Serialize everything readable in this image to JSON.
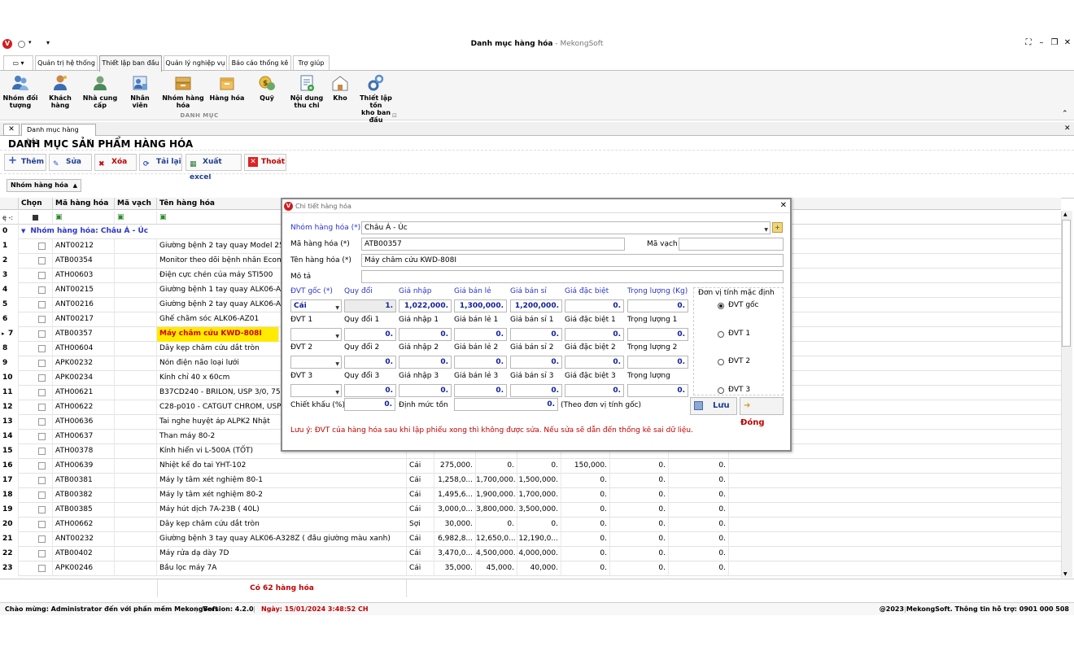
{
  "app": {
    "title": "Danh mục hàng hóa",
    "brand": " - MekongSoft",
    "icon_letter": "V"
  },
  "ribbon": {
    "tabs": [
      "Quản trị hệ thống",
      "Thiết lập ban đầu",
      "Quản lý nghiệp vụ",
      "Báo cáo thống kê",
      "Trợ giúp"
    ],
    "items": [
      {
        "label1": "Nhóm đối",
        "label2": "tượng",
        "icon": "users-group-icon"
      },
      {
        "label1": "Khách",
        "label2": "hàng",
        "icon": "customer-icon"
      },
      {
        "label1": "Nhà cung",
        "label2": "cấp",
        "icon": "supplier-icon"
      },
      {
        "label1": "Nhân viên",
        "label2": "",
        "icon": "employee-icon"
      },
      {
        "label1": "Nhóm hàng",
        "label2": "hóa",
        "icon": "product-group-icon"
      },
      {
        "label1": "Hàng hóa",
        "label2": "",
        "icon": "product-box-icon"
      },
      {
        "label1": "Quỹ",
        "label2": "",
        "icon": "money-bag-icon"
      },
      {
        "label1": "Nội dung",
        "label2": "thu chi",
        "icon": "document-add-icon"
      },
      {
        "label1": "Kho",
        "label2": "",
        "icon": "warehouse-icon"
      },
      {
        "label1": "Thiết lập tồn",
        "label2": "kho ban đầu",
        "icon": "gears-icon"
      }
    ],
    "group_label": "DANH MỤC"
  },
  "doc_tab": "Danh mục hàng hóa",
  "page_title": "DANH MỤC SẢN PHẨM HÀNG HÓA",
  "toolbar": {
    "add": "Thêm",
    "edit": "Sửa",
    "delete": "Xóa",
    "reload": "Tải lại",
    "export": "Xuất excel",
    "exit": "Thoát"
  },
  "group_by": "Nhóm hàng hóa",
  "grid": {
    "headers": {
      "chon": "Chọn",
      "ma": "Mã hàng hóa",
      "mavach": "Mã vạch",
      "ten": "Tên hàng hóa"
    },
    "filter_icon": "ę -:",
    "group_row": {
      "num": "0",
      "label": "Nhóm hàng hóa: Châu Á - Úc"
    },
    "rows": [
      {
        "n": "1",
        "ma": "ANT00212",
        "ten": "Giường bệnh 2 tay quay Model 250",
        "dvt": "",
        "a": "",
        "b": "",
        "c": "",
        "d": "",
        "e": "",
        "f": ""
      },
      {
        "n": "2",
        "ma": "ATB00354",
        "ten": "Monitor theo dõi bệnh nhân Ecome",
        "dvt": "",
        "a": "",
        "b": "",
        "c": "",
        "d": "",
        "e": "",
        "f": ""
      },
      {
        "n": "3",
        "ma": "ATH00603",
        "ten": "Điện cực chén của máy STI500",
        "dvt": "",
        "a": "",
        "b": "",
        "c": "",
        "d": "",
        "e": "",
        "f": ""
      },
      {
        "n": "4",
        "ma": "ANT00215",
        "ten": "Giường bệnh 1 tay quay ALK06-A1",
        "dvt": "",
        "a": "",
        "b": "",
        "c": "",
        "d": "",
        "e": "",
        "f": ""
      },
      {
        "n": "5",
        "ma": "ANT00216",
        "ten": "Giường bệnh 2 tay quay ALK06-A2",
        "dvt": "",
        "a": "",
        "b": "",
        "c": "",
        "d": "",
        "e": "",
        "f": ""
      },
      {
        "n": "6",
        "ma": "ANT00217",
        "ten": "Ghế chăm sóc ALK06-AZ01",
        "dvt": "",
        "a": "",
        "b": "",
        "c": "",
        "d": "",
        "e": "",
        "f": ""
      },
      {
        "n": "7",
        "ma": "ATB00357",
        "ten": "Máy châm cứu KWD-808I",
        "dvt": "",
        "a": "",
        "b": "",
        "c": "",
        "d": "",
        "e": "",
        "f": "",
        "selected": true
      },
      {
        "n": "8",
        "ma": "ATH00604",
        "ten": "Dây kẹp châm cứu dắt tròn",
        "dvt": "",
        "a": "",
        "b": "",
        "c": "",
        "d": "",
        "e": "",
        "f": ""
      },
      {
        "n": "9",
        "ma": "APK00232",
        "ten": "Nón điện não loại lưới",
        "dvt": "",
        "a": "",
        "b": "",
        "c": "",
        "d": "",
        "e": "",
        "f": ""
      },
      {
        "n": "10",
        "ma": "APK00234",
        "ten": "Kính chỉ 40 x 60cm",
        "dvt": "",
        "a": "",
        "b": "",
        "c": "",
        "d": "",
        "e": "",
        "f": ""
      },
      {
        "n": "11",
        "ma": "ATH00621",
        "ten": "B37CD240 - BRILON, USP 3/0, 75c",
        "dvt": "",
        "a": "",
        "b": "",
        "c": "",
        "d": "",
        "e": "",
        "f": ""
      },
      {
        "n": "12",
        "ma": "ATH00622",
        "ten": "C28-p010 - CATGUT CHROM, USP",
        "dvt": "",
        "a": "",
        "b": "",
        "c": "",
        "d": "",
        "e": "",
        "f": ""
      },
      {
        "n": "13",
        "ma": "ATH00636",
        "ten": "Tai nghe huyệt áp ALPK2 Nhật",
        "dvt": "",
        "a": "",
        "b": "",
        "c": "",
        "d": "",
        "e": "",
        "f": ""
      },
      {
        "n": "14",
        "ma": "ATH00637",
        "ten": "Than máy 80-2",
        "dvt": "",
        "a": "",
        "b": "",
        "c": "",
        "d": "",
        "e": "",
        "f": ""
      },
      {
        "n": "15",
        "ma": "ATH00378",
        "ten": "Kính hiển vi L-500A (TỐT)",
        "dvt": "",
        "a": "",
        "b": "",
        "c": "",
        "d": "",
        "e": "",
        "f": ""
      },
      {
        "n": "16",
        "ma": "ATH00639",
        "ten": "Nhiệt kế đo tai YHT-102",
        "dvt": "Cái",
        "a": "275,000.",
        "b": "0.",
        "c": "0.",
        "d": "150,000.",
        "e": "0.",
        "f": "0."
      },
      {
        "n": "17",
        "ma": "ATB00381",
        "ten": "Máy ly tâm xét nghiệm 80-1",
        "dvt": "Cái",
        "a": "1,258,0...",
        "b": "1,700,000.",
        "c": "1,500,000.",
        "d": "0.",
        "e": "0.",
        "f": "0."
      },
      {
        "n": "18",
        "ma": "ATB00382",
        "ten": "Máy ly tâm xét nghiệm 80-2",
        "dvt": "Cái",
        "a": "1,495,6...",
        "b": "1,900,000.",
        "c": "1,700,000.",
        "d": "0.",
        "e": "0.",
        "f": "0."
      },
      {
        "n": "19",
        "ma": "ATB00385",
        "ten": "Máy hút dịch 7A-23B ( 40L)",
        "dvt": "Cái",
        "a": "3,000,0...",
        "b": "3,800,000.",
        "c": "3,500,000.",
        "d": "0.",
        "e": "0.",
        "f": "0."
      },
      {
        "n": "20",
        "ma": "ATH00662",
        "ten": "Dây kẹp châm cứu dắt tròn",
        "dvt": "Sợi",
        "a": "30,000.",
        "b": "0.",
        "c": "0.",
        "d": "0.",
        "e": "0.",
        "f": "0."
      },
      {
        "n": "21",
        "ma": "ANT00232",
        "ten": "Giường bệnh 3 tay quay ALK06-A328Z ( đầu giường màu xanh)",
        "dvt": "Cái",
        "a": "6,982,8...",
        "b": "12,650,0...",
        "c": "12,190,0...",
        "d": "0.",
        "e": "0.",
        "f": "0."
      },
      {
        "n": "22",
        "ma": "ATB00402",
        "ten": "Máy rửa dạ dày 7D",
        "dvt": "Cái",
        "a": "3,470,0...",
        "b": "4,500,000.",
        "c": "4,000,000.",
        "d": "0.",
        "e": "0.",
        "f": "0."
      },
      {
        "n": "23",
        "ma": "APK00246",
        "ten": "Bầu lọc máy 7A",
        "dvt": "Cái",
        "a": "35,000.",
        "b": "45,000.",
        "c": "40,000.",
        "d": "0.",
        "e": "0.",
        "f": "0."
      }
    ],
    "footer": "Có 62 hàng hóa"
  },
  "dialog": {
    "title": "Chi tiết hàng hóa",
    "nhom_label": "Nhóm hàng hóa (*)",
    "nhom_value": "Châu Á - Úc",
    "ma_label": "Mã hàng hóa (*)",
    "ma_value": "ATB00357",
    "mavach_label": "Mã vạch",
    "mavach_value": "",
    "ten_label": "Tên hàng hóa (*)",
    "ten_value": "Máy châm cứu KWD-808I",
    "mota_label": "Mô tả",
    "mota_value": "",
    "units": [
      {
        "h": [
          "ĐVT gốc (*)",
          "Quy đổi",
          "Giá nhập",
          "Giá bán lẻ",
          "Giá bán sỉ",
          "Giá đặc biệt",
          "Trọng lượng (Kg)"
        ],
        "dvt": "Cái",
        "v": [
          "1.",
          "1,022,000.",
          "1,300,000.",
          "1,200,000.",
          "0.",
          "0."
        ],
        "radio": "ĐVT gốc"
      },
      {
        "h": [
          "ĐVT 1",
          "Quy đổi  1",
          "Giá nhập 1",
          "Giá bán lẻ 1",
          "Giá bán sỉ 1",
          "Giá đặc biệt 1",
          "Trọng lượng 1"
        ],
        "dvt": "",
        "v": [
          "0.",
          "0.",
          "0.",
          "0.",
          "0.",
          "0."
        ],
        "radio": "ĐVT 1"
      },
      {
        "h": [
          "ĐVT 2",
          "Quy đổi 2",
          "Giá nhập 2",
          "Giá bán lẻ 2",
          "Giá bán sỉ 2",
          "Giá đặc biệt 2",
          "Trọng lượng 2"
        ],
        "dvt": "",
        "v": [
          "0.",
          "0.",
          "0.",
          "0.",
          "0.",
          "0."
        ],
        "radio": "ĐVT 2"
      },
      {
        "h": [
          "ĐVT 3",
          "Quy đổi 3",
          "Giá nhập 3",
          "Giá bán lẻ 3",
          "Giá bán sỉ 3",
          "Giá đặc biệt 3",
          "Trọng lượng"
        ],
        "dvt": "",
        "v": [
          "0.",
          "0.",
          "0.",
          "0.",
          "0.",
          "0."
        ],
        "radio": "ĐVT 3"
      }
    ],
    "default_unit_label": "Đơn vị tính mặc định",
    "chietkhau_label": "Chiết khấu (%)",
    "chietkhau_value": "0.",
    "dinhmuc_label": "Định mức tồn",
    "dinhmuc_value": "0.",
    "dinhmuc_note": "(Theo đơn vị tính gốc)",
    "save": "Lưu",
    "close": "Đóng",
    "note": "Lưu ý: ĐVT của hàng hóa sau khi lập phiếu xong thì không được sửa. Nếu sửa sẽ dẫn đến thống kê sai dữ liệu."
  },
  "status": {
    "welcome": "Chào mừng: Administrator đến với phần mềm MekongSoft",
    "version": "Version: 4.2.0",
    "date": "Ngày: 15/01/2024 3:48:52 CH",
    "copyright": "@2023 MekongSoft. Thông tin hỗ trợ: 0901 000 508"
  },
  "colors": {
    "accent_blue": "#2b35c8",
    "alert_red": "#c00000",
    "highlight": "#ffea00"
  }
}
